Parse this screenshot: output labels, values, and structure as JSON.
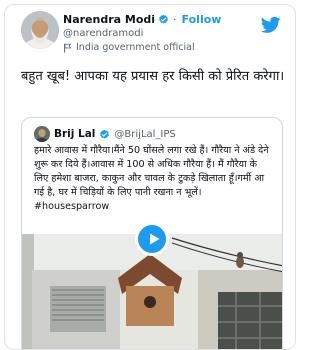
{
  "author": {
    "name": "Narendra Modi",
    "handle": "@narendramodi",
    "follow_label": "Follow",
    "separator": "·",
    "label": "India government official",
    "avatar_icon": "profile-photo",
    "verified_icon": "verified-badge-icon"
  },
  "tweet": {
    "text": "बहुत खूब! आपका यह प्रयास हर किसी को प्रेरित करेगा।"
  },
  "quoted": {
    "name": "Brij Lal",
    "handle": "@BrijLal_IPS",
    "text": "हमारे आवास में गौरैया।मैंने 50 घोंसले लगा रखे हैं। गौरैया ने अंडे देने शुरू कर दिये हैं।आवास में 100 से अधिक गौरैया हैं। मैं गौरैया के लिए हमेशा बाजरा, काकुन और चावल के टुकड़े खिलाता हूँ।गर्मी आ गई है, घर में चिड़ियों के लिए पानी रखना न भूलें।#housesparrow"
  },
  "colors": {
    "brand_blue": "#1d9bf0",
    "verified_blue": "#1d9bf0",
    "text_primary": "#0f1419",
    "text_secondary": "#536471"
  },
  "icons": {
    "brand": "twitter-bird-icon",
    "government": "flag-icon",
    "media": "play-icon"
  }
}
